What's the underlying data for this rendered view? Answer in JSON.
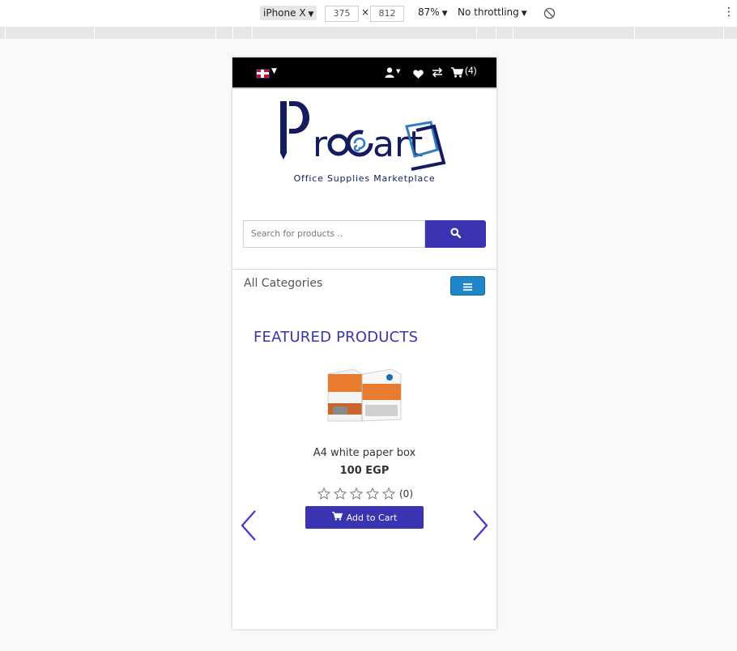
{
  "devtools": {
    "device": "iPhone X",
    "width": "375",
    "height": "812",
    "times": "×",
    "zoom": "87%",
    "throttling": "No throttling"
  },
  "header": {
    "cart_count": "(4)"
  },
  "search": {
    "placeholder": "Search for products .."
  },
  "categories": {
    "label": "All Categories"
  },
  "featured": {
    "title": "FEATURED PRODUCTS",
    "product": {
      "name": "A4 white paper box",
      "price": "100 EGP",
      "rating_count": "(0)",
      "add_to_cart": "Add to Cart"
    }
  },
  "logo": {
    "name": "ProCart",
    "tagline": "Office Supplies Marketplace"
  },
  "colors": {
    "primary": "#3a34b3",
    "menu_button": "#1f86c8",
    "logo_navy": "#141b5e",
    "logo_blue": "#2f7cc4"
  }
}
